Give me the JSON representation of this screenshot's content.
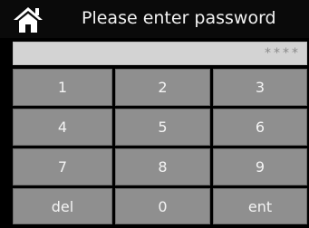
{
  "header": {
    "home_icon": "home-icon",
    "title": "Please enter password"
  },
  "password": {
    "mask": "****"
  },
  "keypad": {
    "keys": [
      "1",
      "2",
      "3",
      "4",
      "5",
      "6",
      "7",
      "8",
      "9",
      "del",
      "0",
      "ent"
    ]
  },
  "colors": {
    "background": "#000000",
    "key_fill": "#8f8f8f",
    "field_fill": "#d3d3d3",
    "text": "#f4f4f4"
  }
}
